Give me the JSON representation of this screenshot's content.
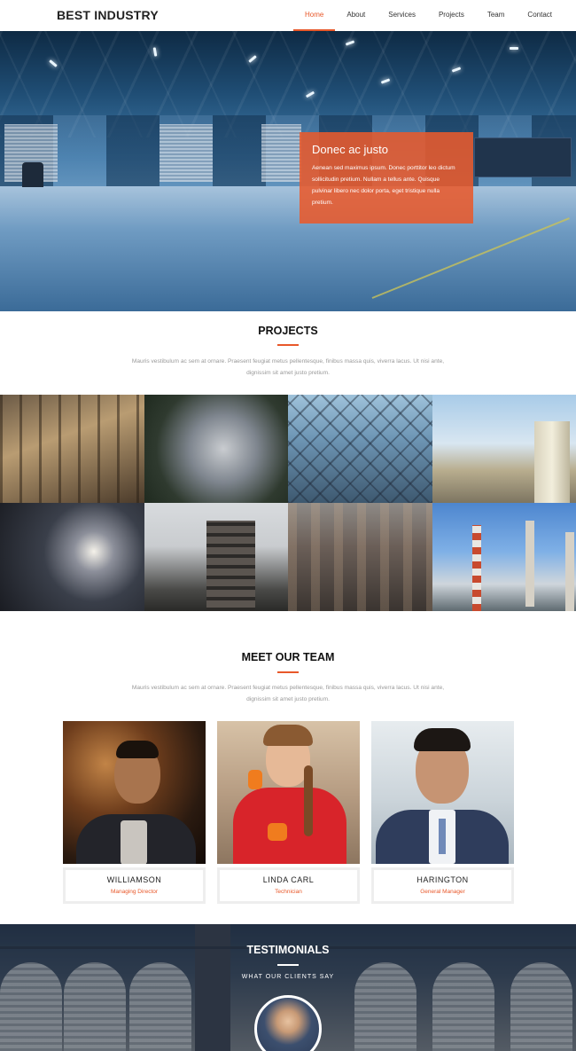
{
  "header": {
    "brand": "BEST INDUSTRY",
    "nav": [
      "Home",
      "About",
      "Services",
      "Projects",
      "Team",
      "Contact"
    ],
    "active_nav": "Home"
  },
  "hero": {
    "title": "Donec ac justo",
    "text": "Aenean sed maximus ipsum. Donec porttitor leo dictum sollicitudin pretium. Nullam a tellus ante. Quisque pulvinar libero nec dolor porta, eget tristique nulla pretium."
  },
  "projects": {
    "title": "PROJECTS",
    "subtitle": "Mauris vestibulum ac sem at ornare. Praesent feugiat metus pellentesque, finibus massa quis, viverra lacus. Ut nisi ante, dignissim sit amet justo pretium."
  },
  "team": {
    "title": "MEET OUR TEAM",
    "subtitle": "Mauris vestibulum ac sem at ornare. Praesent feugiat metus pellentesque, finibus massa quis, viverra lacus. Ut nisi ante, dignissim sit amet justo pretium.",
    "members": [
      {
        "name": "WILLIAMSON",
        "role": "Managing Director"
      },
      {
        "name": "LINDA CARL",
        "role": "Technician"
      },
      {
        "name": "HARINGTON",
        "role": "General Manager"
      }
    ]
  },
  "testimonials": {
    "title": "TESTIMONIALS",
    "subtitle": "WHAT OUR CLIENTS SAY"
  },
  "colors": {
    "accent": "#e8582a",
    "text_dark": "#222222",
    "text_muted": "#999999"
  }
}
